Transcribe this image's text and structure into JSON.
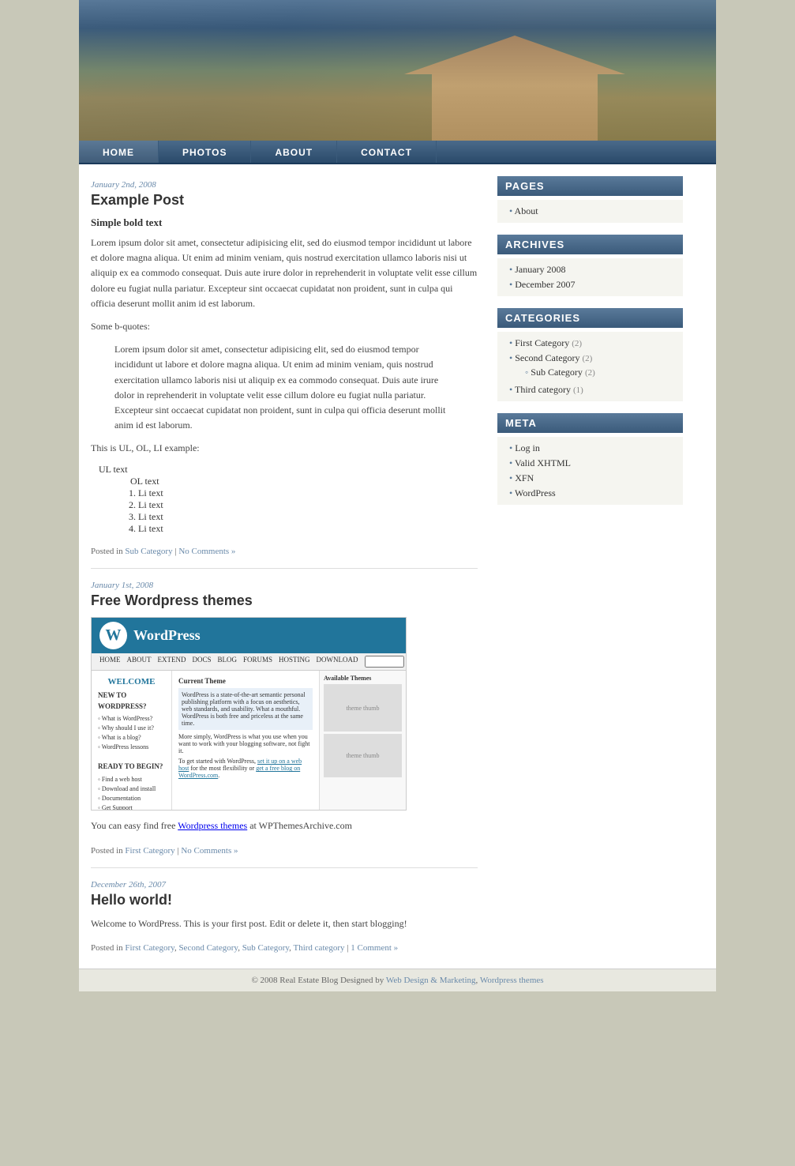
{
  "site": {
    "title": "Real Estate Blog",
    "footer_copy": "© 2008 Real Estate Blog Designed by",
    "footer_link1": "Web Design & Marketing",
    "footer_link2": "Wordpress themes"
  },
  "nav": {
    "items": [
      {
        "label": "HOME",
        "active": true
      },
      {
        "label": "PHOTOS",
        "active": false
      },
      {
        "label": "ABOUT",
        "active": false
      },
      {
        "label": "CONTACT",
        "active": false
      }
    ]
  },
  "sidebar": {
    "pages_header": "PAGES",
    "pages_items": [
      {
        "label": "About",
        "href": "#"
      }
    ],
    "archives_header": "ARCHIVES",
    "archives_items": [
      {
        "label": "January 2008",
        "href": "#"
      },
      {
        "label": "December 2007",
        "href": "#"
      }
    ],
    "categories_header": "CATEGORIES",
    "categories_items": [
      {
        "label": "First Category",
        "count": "(2)",
        "href": "#"
      },
      {
        "label": "Second Category",
        "count": "(2)",
        "href": "#",
        "sub": [
          {
            "label": "Sub Category",
            "count": "(2)",
            "href": "#"
          }
        ]
      },
      {
        "label": "Third category",
        "count": "(1)",
        "href": "#"
      }
    ],
    "meta_header": "META",
    "meta_items": [
      {
        "label": "Log in",
        "href": "#"
      },
      {
        "label": "Valid XHTML",
        "href": "#"
      },
      {
        "label": "XFN",
        "href": "#"
      },
      {
        "label": "WordPress",
        "href": "#"
      }
    ]
  },
  "posts": [
    {
      "date": "January 2nd, 2008",
      "title": "Example Post",
      "subtitle": "Simple bold text",
      "body": "Lorem ipsum dolor sit amet, consectetur adipisicing elit, sed do eiusmod tempor incididunt ut labore et dolore magna aliqua. Ut enim ad minim veniam, quis nostrud exercitation ullamco laboris nisi ut aliquip ex ea commodo consequat. Duis aute irure dolor in reprehenderit in voluptate velit esse cillum dolore eu fugiat nulla pariatur. Excepteur sint occaecat cupidatat non proident, sunt in culpa qui officia deserunt mollit anim id est laborum.",
      "blockquote_label": "Some b-quotes:",
      "blockquote": "Lorem ipsum dolor sit amet, consectetur adipisicing elit, sed do eiusmod tempor incididunt ut labore et dolore magna aliqua. Ut enim ad minim veniam, quis nostrud exercitation ullamco laboris nisi ut aliquip ex ea commodo consequat. Duis aute irure dolor in reprehenderit in voluptate velit esse cillum dolore eu fugiat nulla pariatur. Excepteur sint occaecat cupidatat non proident, sunt in culpa qui officia deserunt mollit anim id est laborum.",
      "list_label": "This is UL, OL, LI example:",
      "ul_label": "UL text",
      "ol_label": "OL text",
      "li_label": "Li text",
      "posted_in": "Posted in",
      "posted_categories": [
        {
          "label": "Sub Category",
          "href": "#"
        }
      ],
      "comments": "No Comments »",
      "comments_href": "#"
    },
    {
      "date": "January 1st, 2008",
      "title": "Free Wordpress themes",
      "body_prefix": "You can easy find free",
      "body_link": "Wordpress themes",
      "body_link_href": "#",
      "body_suffix": "at WPThemesArchive.com",
      "posted_in": "Posted in",
      "posted_categories": [
        {
          "label": "First Category",
          "href": "#"
        }
      ],
      "comments": "No Comments »",
      "comments_href": "#"
    },
    {
      "date": "December 26th, 2007",
      "title": "Hello world!",
      "body": "Welcome to WordPress. This is your first post. Edit or delete it, then start blogging!",
      "posted_in": "Posted in",
      "posted_categories": [
        {
          "label": "First Category",
          "href": "#"
        },
        {
          "label": "Second Category",
          "href": "#"
        },
        {
          "label": "Sub Category",
          "href": "#"
        },
        {
          "label": "Third category",
          "href": "#"
        }
      ],
      "comments": "1 Comment »",
      "comments_href": "#"
    }
  ],
  "icons": {
    "bullet": "•",
    "sub_bullet": "◦"
  }
}
